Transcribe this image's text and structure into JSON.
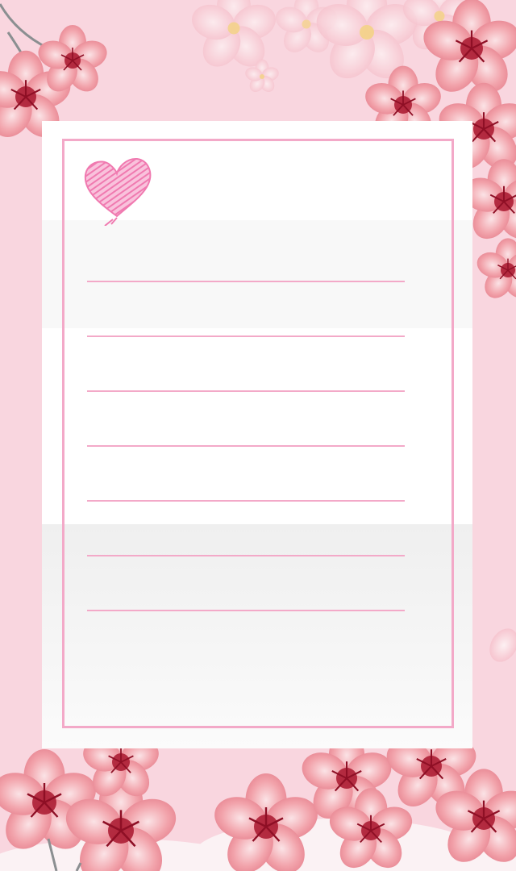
{
  "theme": {
    "background": "#f9d6df",
    "card": "#ffffff",
    "frame_color": "#f3a9c8",
    "line_color": "#f3a9c8",
    "heart_color": "#f07ab0",
    "blossom_petal": "#f2a3ab",
    "blossom_center": "#a8162e"
  },
  "note_card": {
    "icon": "heart-icon",
    "line_count": 7
  }
}
